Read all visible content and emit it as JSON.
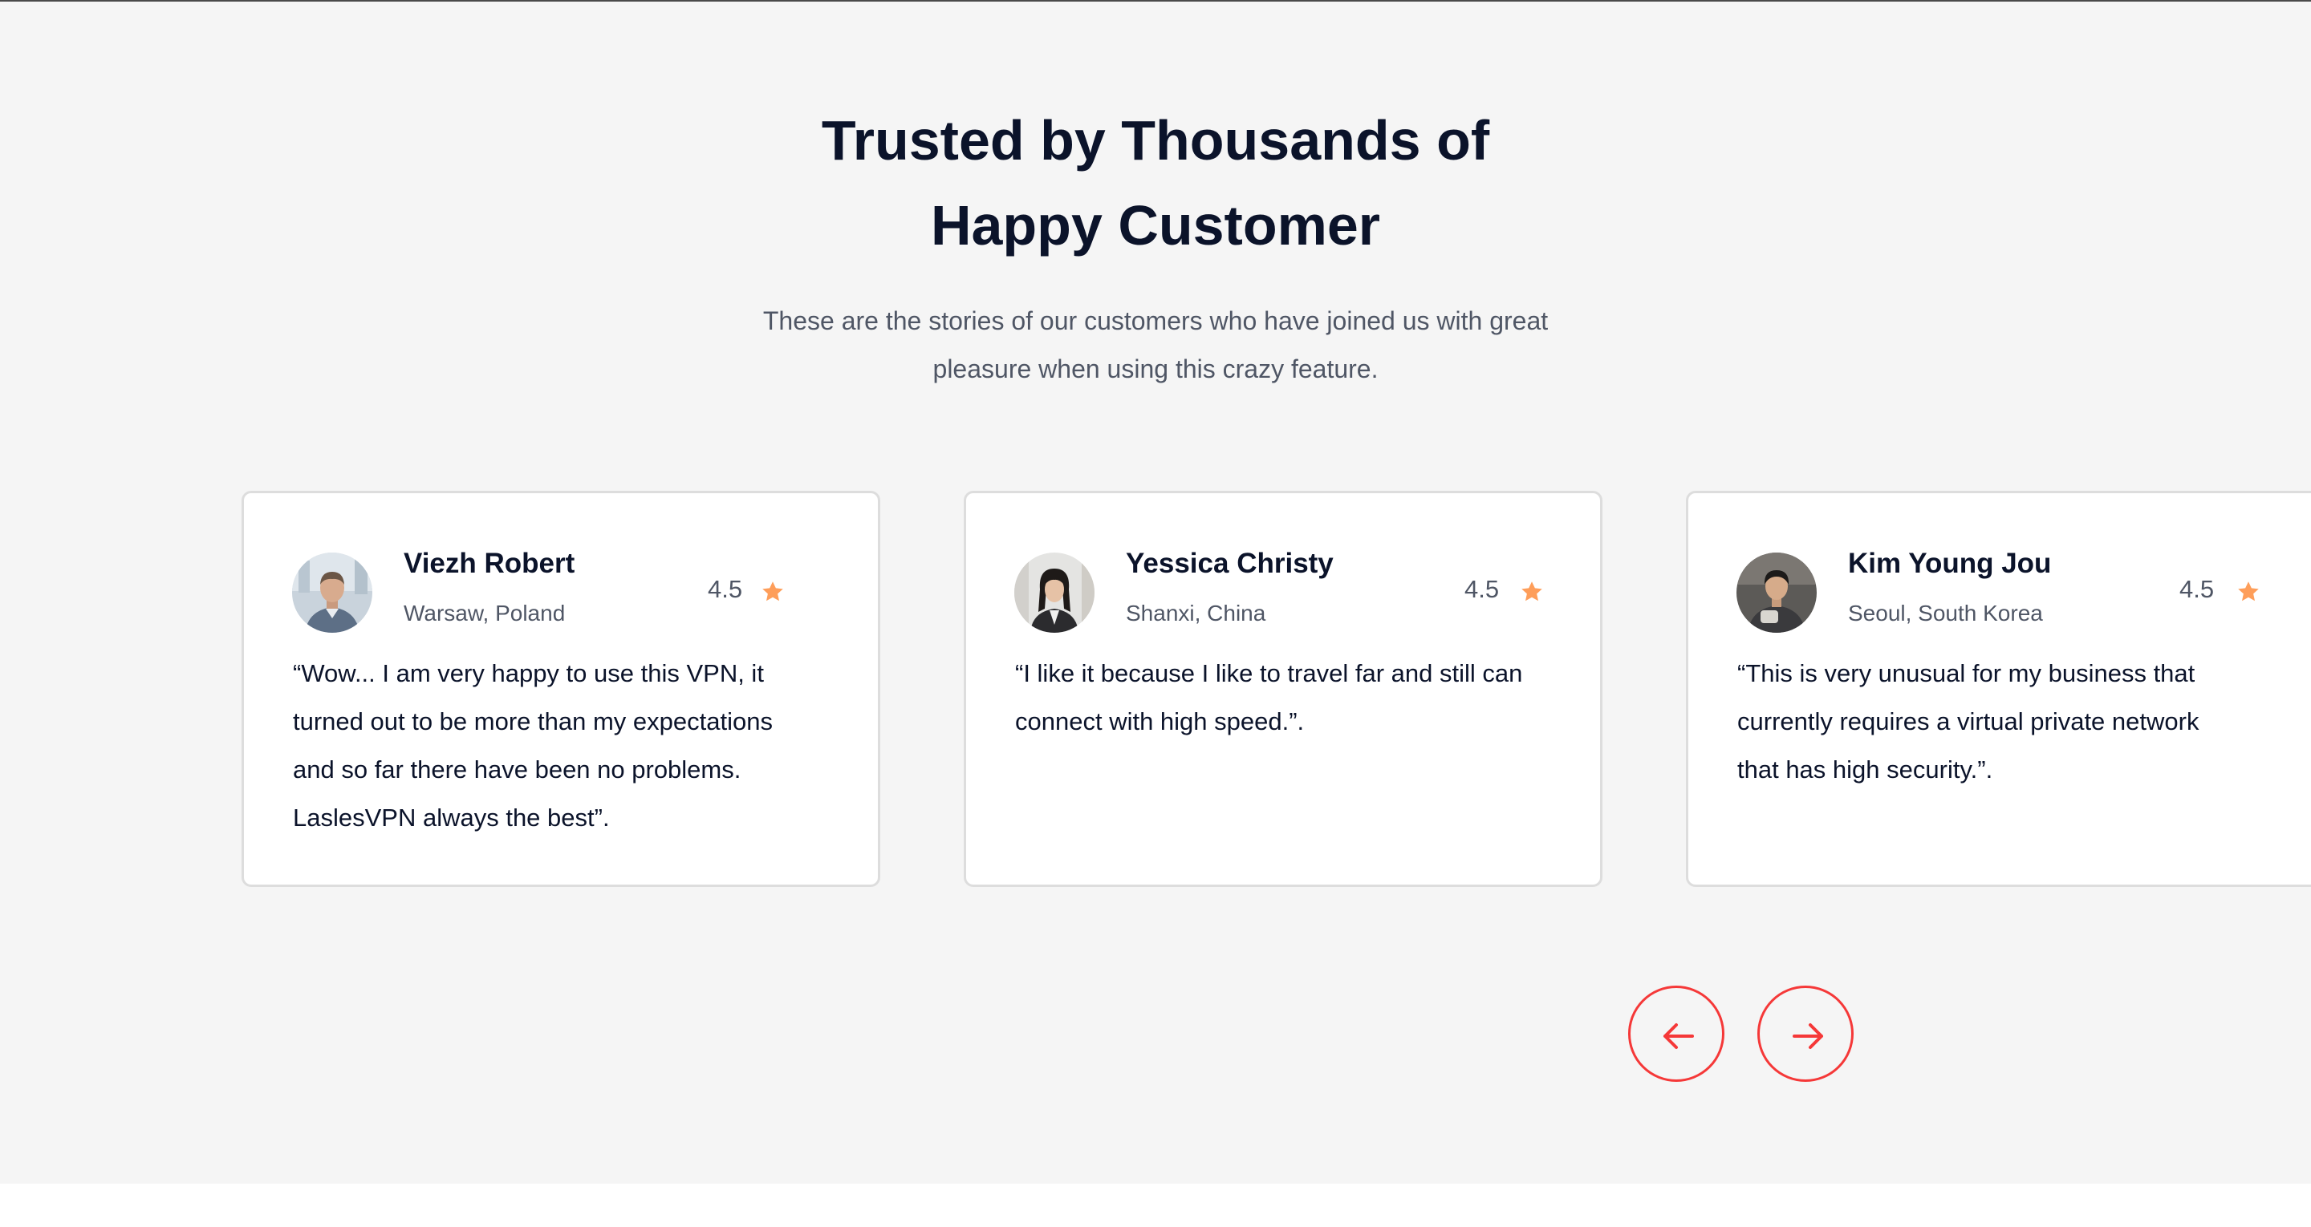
{
  "section": {
    "title_lines": [
      "Trusted by Thousands of",
      "Happy Customer"
    ],
    "subtitle_lines": [
      "These are the stories of our customers who have joined us with great",
      "pleasure when using this crazy feature."
    ]
  },
  "testimonials": [
    {
      "name": "Viezh Robert",
      "location": "Warsaw, Poland",
      "rating": "4.5",
      "quote_lines": [
        "“Wow... I am very happy to use this VPN, it",
        "turned out to be more than my expectations",
        "and so far there have been no problems.",
        "LaslesVPN always the best”."
      ]
    },
    {
      "name": "Yessica Christy",
      "location": "Shanxi, China",
      "rating": "4.5",
      "quote_lines": [
        "“I like it because I like to travel far and still can",
        "connect with high speed.”."
      ]
    },
    {
      "name": "Kim Young Jou",
      "location": "Seoul, South Korea",
      "rating": "4.5",
      "quote_lines": [
        "“This is very unusual for my business that",
        "currently requires a virtual private network",
        "that has high security.”."
      ]
    }
  ],
  "carousel": {
    "prev_icon": "arrow-left-icon",
    "next_icon": "arrow-right-icon"
  },
  "colors": {
    "heading": "#0b132a",
    "body_text": "#4f5665",
    "accent": "#f53838",
    "star": "#fe9e5a",
    "section_background": "#f5f5f5",
    "card_border": "#dddddd"
  }
}
